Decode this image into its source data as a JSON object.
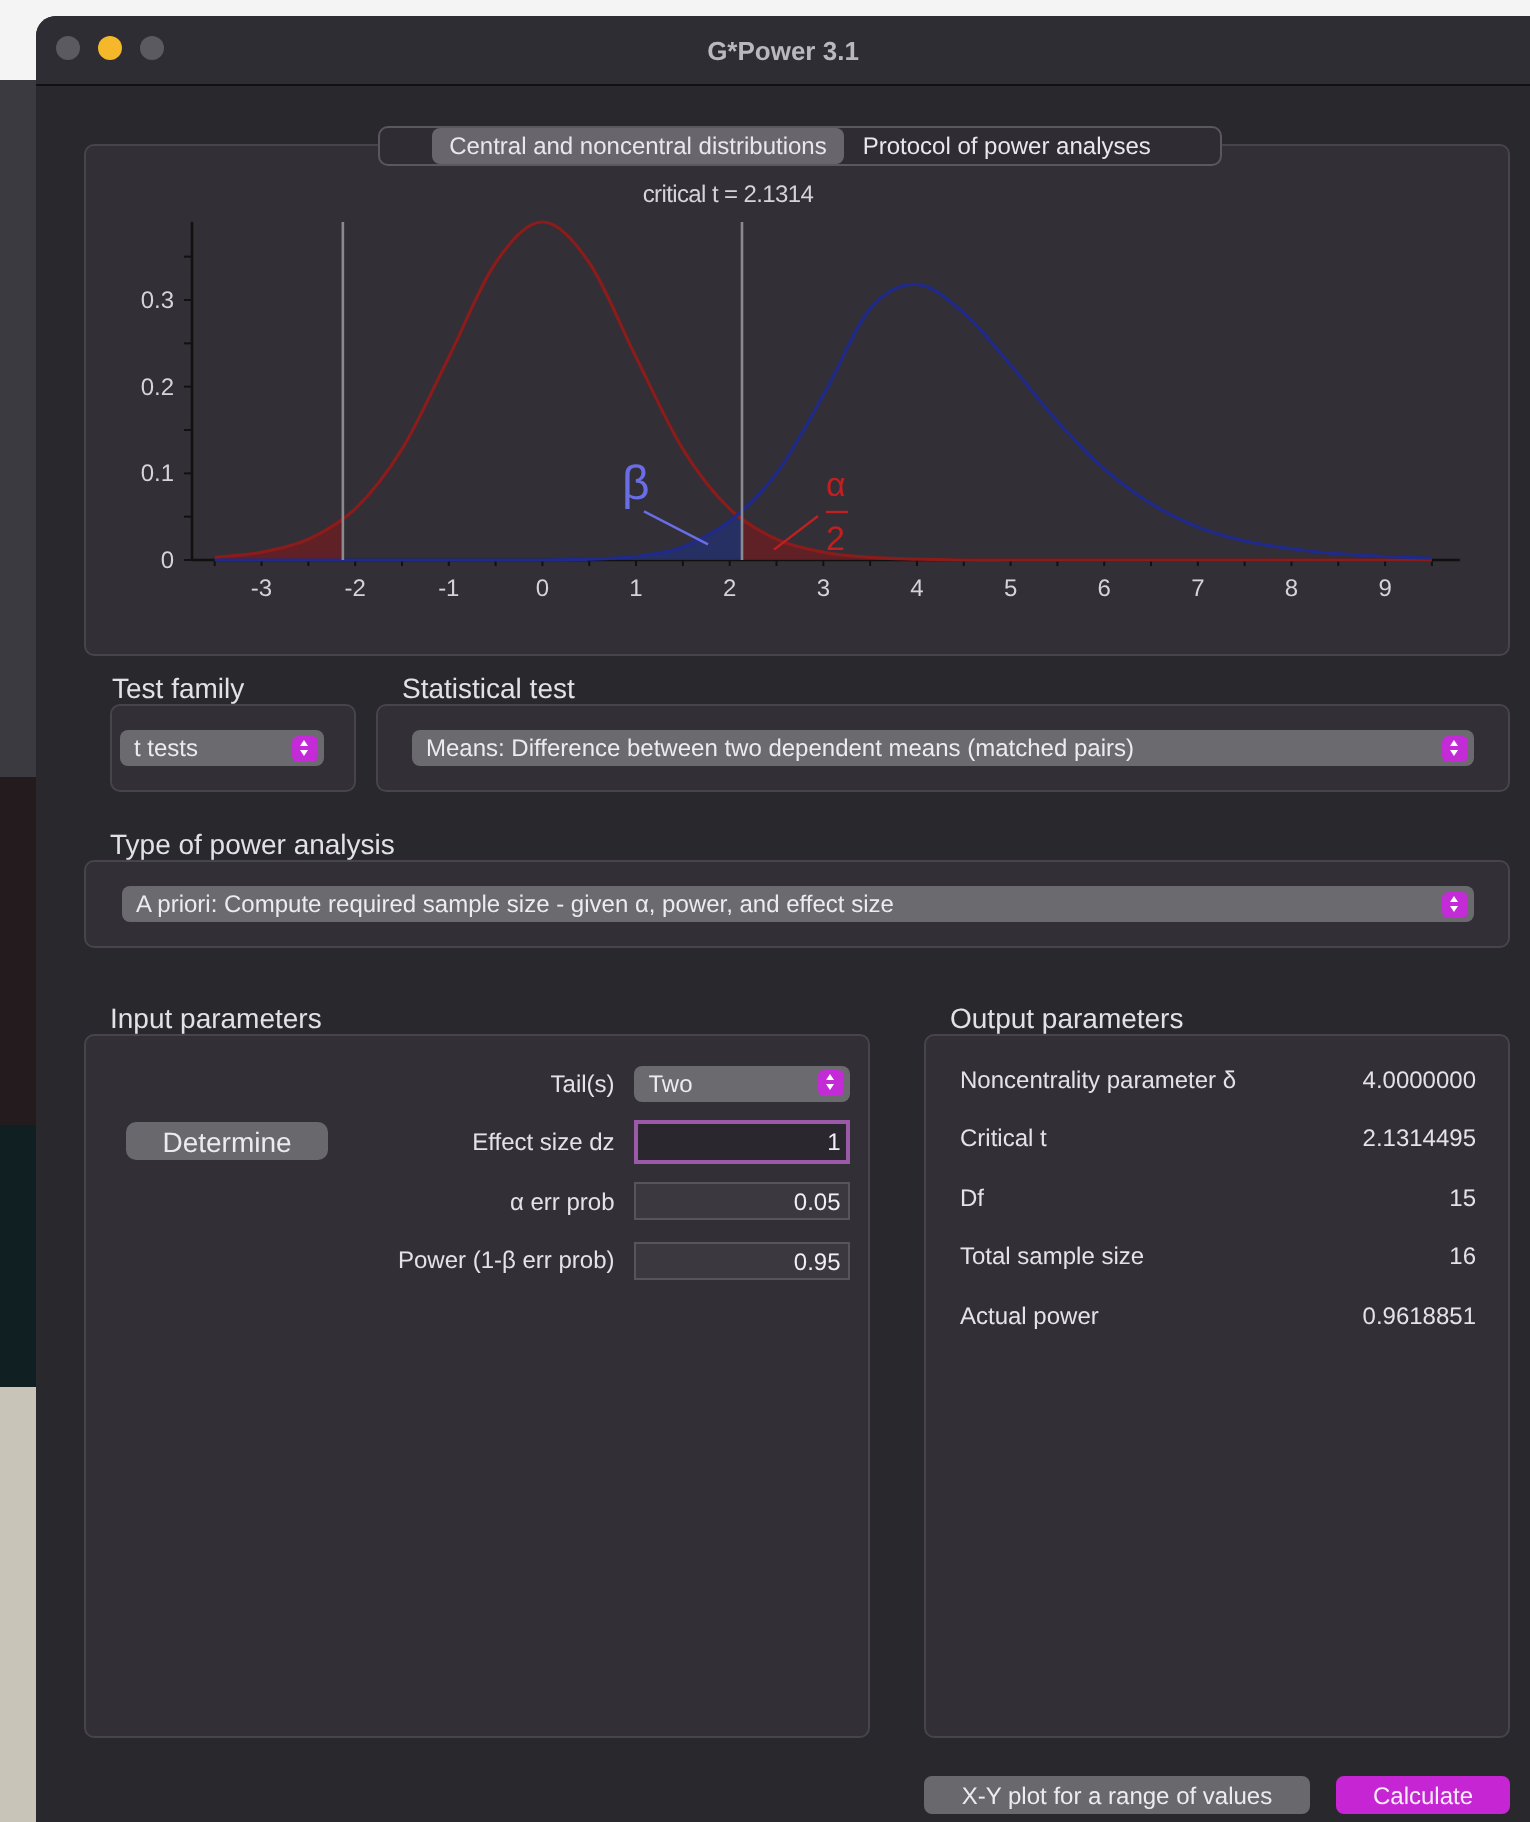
{
  "window": {
    "title": "G*Power 3.1"
  },
  "tabs": [
    {
      "label": "Central and noncentral distributions",
      "selected": true
    },
    {
      "label": "Protocol of power analyses",
      "selected": false
    }
  ],
  "plot": {
    "chart_data": {
      "type": "line",
      "title": "critical t = 2.1314",
      "x": [
        -3.5,
        -3,
        -2.5,
        -2,
        -1.5,
        -1,
        -0.5,
        0,
        0.5,
        1,
        1.5,
        2,
        2.5,
        3,
        3.5,
        4,
        4.5,
        5,
        5.5,
        6,
        6.5,
        7,
        7.5,
        8,
        8.5,
        9,
        9.5
      ],
      "series": [
        {
          "color": "#8a1c1c",
          "values": [
            0.003,
            0.009,
            0.024,
            0.059,
            0.128,
            0.234,
            0.343,
            0.39,
            0.343,
            0.234,
            0.128,
            0.059,
            0.024,
            0.009,
            0.003,
            0.001,
            0,
            0,
            0,
            0,
            0,
            0,
            0,
            0,
            0,
            0,
            0
          ]
        },
        {
          "color": "#1f2a8a",
          "values": [
            0,
            0,
            0,
            0,
            0,
            0,
            0,
            0,
            0.001,
            0.004,
            0.015,
            0.045,
            0.1,
            0.19,
            0.29,
            0.318,
            0.285,
            0.225,
            0.16,
            0.105,
            0.065,
            0.038,
            0.022,
            0.013,
            0.007,
            0.004,
            0.002
          ]
        }
      ],
      "xlim": [
        -3.7,
        9.8
      ],
      "ylim": [
        0,
        0.39
      ],
      "xticks": [
        -3,
        -2,
        -1,
        0,
        1,
        2,
        3,
        4,
        5,
        6,
        7,
        8,
        9
      ],
      "yticks": [
        0,
        0.1,
        0.2,
        0.3
      ],
      "ref_lines": [
        {
          "axis": "x",
          "value": -2.1314
        },
        {
          "axis": "x",
          "value": 2.1314
        }
      ],
      "annotations": [
        "β",
        "α",
        "2"
      ]
    }
  },
  "test_family": {
    "label": "Test family",
    "value": "t tests"
  },
  "statistical_test": {
    "label": "Statistical test",
    "value": "Means: Difference between two dependent means (matched pairs)"
  },
  "power_analysis_type": {
    "label": "Type of power analysis",
    "value": "A priori: Compute required sample size - given α, power, and effect size"
  },
  "input_parameters": {
    "title": "Input parameters",
    "determine_button": "Determine",
    "fields": [
      {
        "label": "Tail(s)",
        "kind": "select",
        "value": "Two",
        "focused": false
      },
      {
        "label": "Effect size dz",
        "kind": "input",
        "value": "1",
        "focused": true
      },
      {
        "label": "α err prob",
        "kind": "input",
        "value": "0.05",
        "focused": false
      },
      {
        "label": "Power (1-β err prob)",
        "kind": "input",
        "value": "0.95",
        "focused": false
      }
    ]
  },
  "output_parameters": {
    "title": "Output parameters",
    "rows": [
      {
        "label": "Noncentrality parameter δ",
        "value": "4.0000000"
      },
      {
        "label": "Critical t",
        "value": "2.1314495"
      },
      {
        "label": "Df",
        "value": "15"
      },
      {
        "label": "Total sample size",
        "value": "16"
      },
      {
        "label": "Actual power",
        "value": "0.9618851"
      }
    ]
  },
  "buttons": [
    {
      "label": "X-Y plot for a range of values",
      "kind": "secondary"
    },
    {
      "label": "Calculate",
      "kind": "primary"
    }
  ]
}
